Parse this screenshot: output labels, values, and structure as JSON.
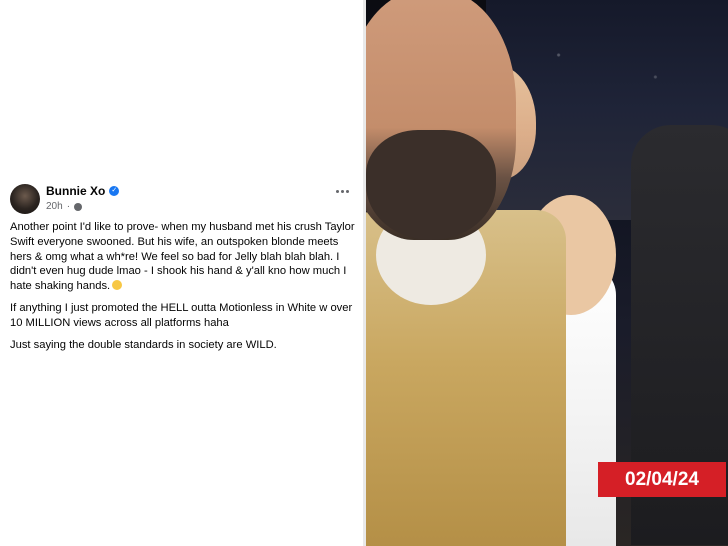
{
  "post": {
    "author": "Bunnie Xo",
    "time": "20h",
    "paragraphs": [
      "Another point I'd like to prove- when my husband met his crush Taylor Swift everyone swooned. But his wife, an outspoken blonde meets hers & omg what a wh*re! We feel so bad for Jelly blah blah blah. I didn't even hug dude lmao - I shook his hand & y'all kno how much I hate shaking hands.",
      "If anything I just promoted the HELL outta Motionless in White w over 10 MILLION views across all platforms haha",
      "Just saying the double standards in society are WILD."
    ],
    "icons": {
      "verified": "verified-badge-icon",
      "privacy": "globe-icon",
      "more": "more-options-icon",
      "emoji": "laughing-emoji-icon"
    }
  },
  "photo": {
    "date_label": "02/04/24"
  },
  "colors": {
    "verified_blue": "#1877f2",
    "badge_red": "#d51f26",
    "text_primary": "#050505",
    "text_secondary": "#65676b"
  }
}
